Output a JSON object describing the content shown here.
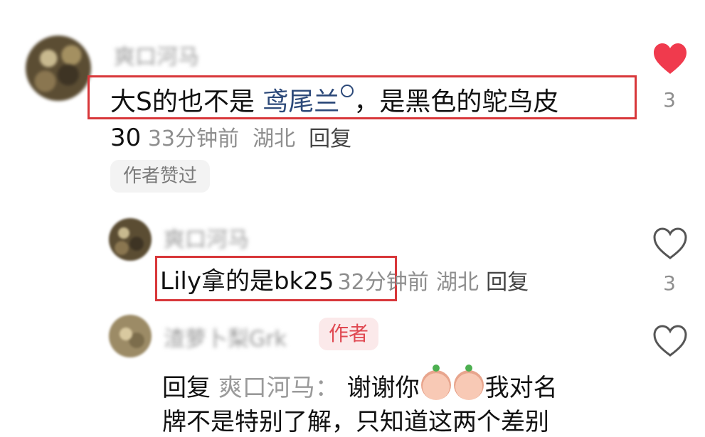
{
  "comments": [
    {
      "name": "爽口河马",
      "text_before": "大S的也不是 ",
      "link": "鸢尾兰",
      "link_icon": "search-icon",
      "text_after": "，是黑色的鸵鸟皮",
      "meta_prefix": "30",
      "time": "33分钟前",
      "location": "湖北",
      "reply": "回复",
      "badge": "作者赞过",
      "likes": "3",
      "liked": true
    },
    {
      "name": "爽口河马",
      "text": "Lily拿的是bk25",
      "time": "32分钟前",
      "location": "湖北",
      "reply": "回复",
      "likes": "3",
      "liked": false
    },
    {
      "name": "渣萝卜梨Grk",
      "author_tag": "作者",
      "reply_prefix": "回复",
      "reply_to": "爽口河马：",
      "text_start": "谢谢你",
      "text_end": "我对名",
      "text_line2": "牌不是特别了解，只知道这两个差别",
      "emoji": "crying-face-icon",
      "likes": "",
      "liked": false
    }
  ],
  "colors": {
    "heart_active": "#f03a4d",
    "highlight_box": "#d8373a",
    "link": "#2d4a7a"
  }
}
